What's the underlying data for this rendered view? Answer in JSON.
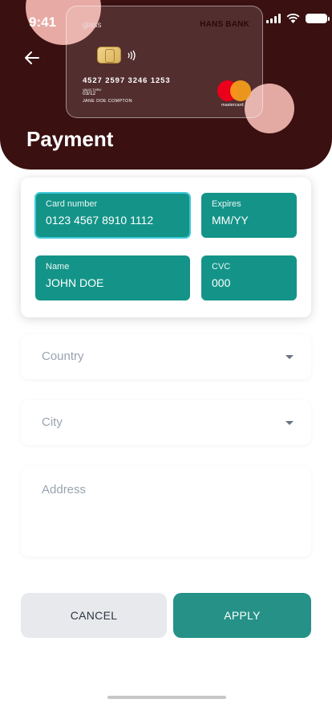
{
  "status_bar": {
    "time": "9:41",
    "icons": [
      "cellular-signal-icon",
      "wifi-icon",
      "battery-icon"
    ]
  },
  "header": {
    "title": "Payment",
    "back_icon": "arrow-left-icon",
    "background_color": "#3a1010"
  },
  "credit_card": {
    "brand_text": "glass",
    "bank_name": "HANS BANK",
    "number": "4527 2597 3246 1253",
    "valid_thru_label": "VALID THRU",
    "expiry": "03/12",
    "holder": "JANE DOE COMPTON",
    "network": "mastercard"
  },
  "form": {
    "card_number": {
      "label": "Card number",
      "value": "0123 4567 8910 1112"
    },
    "expires": {
      "label": "Expires",
      "value": "MM/YY"
    },
    "name": {
      "label": "Name",
      "value": "JOHN DOE"
    },
    "cvc": {
      "label": "CVC",
      "value": "000"
    },
    "field_color": "#149488",
    "focus_color": "#40c9d9"
  },
  "country": {
    "placeholder": "Country"
  },
  "city": {
    "placeholder": "City"
  },
  "address": {
    "placeholder": "Address"
  },
  "actions": {
    "cancel_label": "CANCEL",
    "apply_label": "APPLY",
    "apply_color": "#259187"
  }
}
